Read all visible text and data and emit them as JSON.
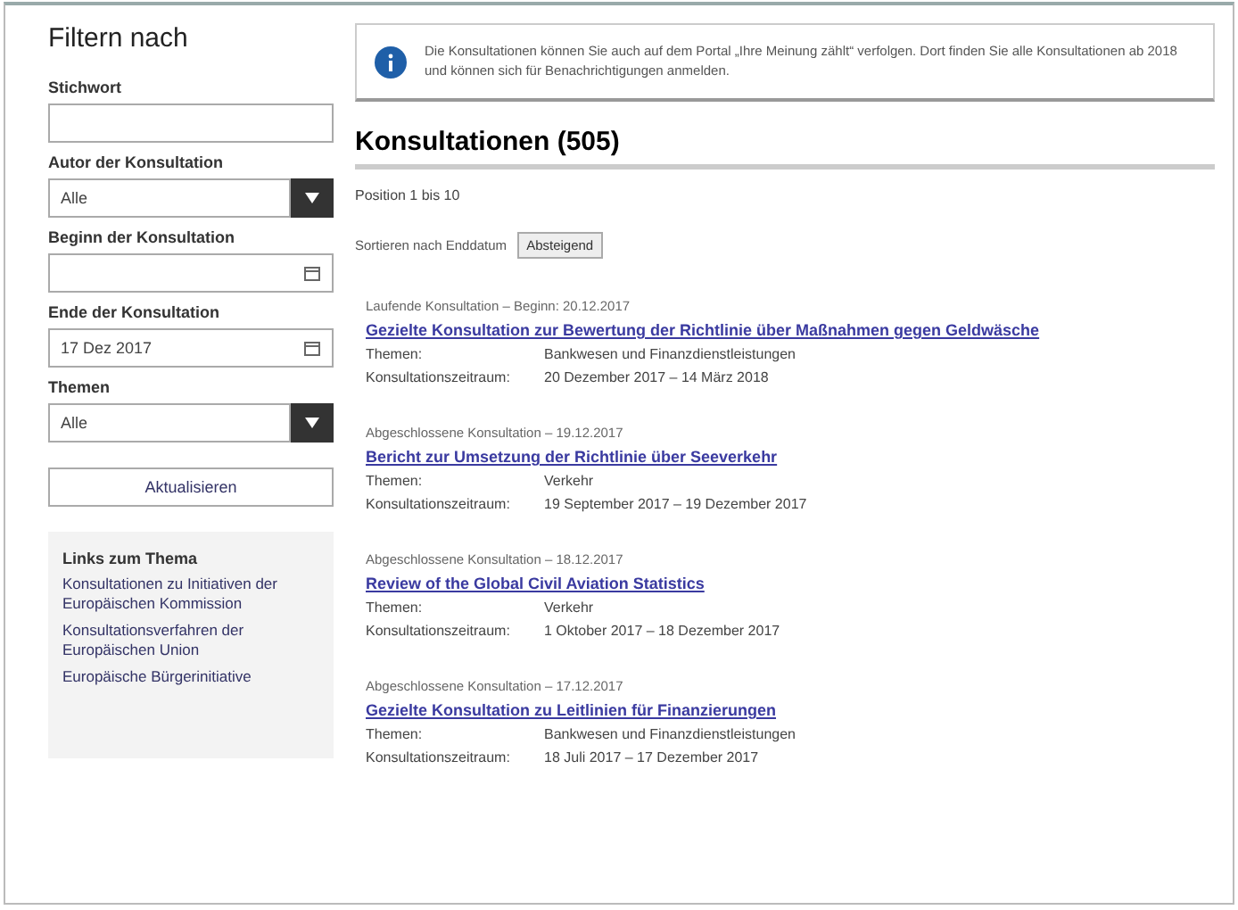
{
  "sidebar": {
    "title": "Filtern nach",
    "filters": [
      {
        "kind": "text",
        "label": "Stichwort"
      },
      {
        "kind": "select",
        "label": "Autor der Konsultation",
        "value": "Alle"
      },
      {
        "kind": "date",
        "label": "Beginn der Konsultation"
      },
      {
        "kind": "date",
        "label": "Ende der Konsultation",
        "value": "17 Dez 2017"
      },
      {
        "kind": "select",
        "label": "Themen",
        "value": "Alle"
      }
    ],
    "apply_button": "Aktualisieren",
    "links_title": "Links zum Thema",
    "links": [
      "Konsultationen zu Initiativen der Europäischen Kommission",
      "Konsultationsverfahren der Europäischen Union",
      "Europäische Bürgerinitiative"
    ]
  },
  "notice": {
    "text": "Die Konsultationen können Sie auch auf dem Portal „Ihre Meinung zählt“ verfolgen. Dort finden Sie alle Konsultationen ab 2018 und können sich für Benachrichtigungen anmelden."
  },
  "results": {
    "title": "Konsultationen (505)",
    "range": "Position 1 bis 10",
    "sort_label": "Sortieren nach Enddatum",
    "sort_value": "Absteigend",
    "items": [
      {
        "status": "Laufende Konsultation – Beginn: 20.12.2017",
        "title": "Gezielte Konsultation zur Bewertung der Richtlinie über Maßnahmen gegen Geldwäsche",
        "fields": [
          {
            "label": "Themen:",
            "value": "Bankwesen und Finanzdienstleistungen"
          },
          {
            "label": "Konsultationszeitraum:",
            "value": "20 Dezember 2017 – 14 März 2018"
          }
        ]
      },
      {
        "status": "Abgeschlossene Konsultation – 19.12.2017",
        "title": "Bericht zur Umsetzung der Richtlinie über Seeverkehr",
        "fields": [
          {
            "label": "Themen:",
            "value": "Verkehr"
          },
          {
            "label": "Konsultationszeitraum:",
            "value": "19 September 2017 – 19 Dezember 2017"
          }
        ]
      },
      {
        "status": "Abgeschlossene Konsultation – 18.12.2017",
        "title": "Review of the Global Civil Aviation Statistics",
        "fields": [
          {
            "label": "Themen:",
            "value": "Verkehr"
          },
          {
            "label": "Konsultationszeitraum:",
            "value": "1 Oktober 2017 – 18 Dezember 2017"
          }
        ]
      },
      {
        "status": "Abgeschlossene Konsultation – 17.12.2017",
        "title": "Gezielte Konsultation zu Leitlinien für Finanzierungen",
        "fields": [
          {
            "label": "Themen:",
            "value": "Bankwesen und Finanzdienstleistungen"
          },
          {
            "label": "Konsultationszeitraum:",
            "value": "18 Juli 2017 – 17 Dezember 2017"
          }
        ]
      }
    ]
  }
}
